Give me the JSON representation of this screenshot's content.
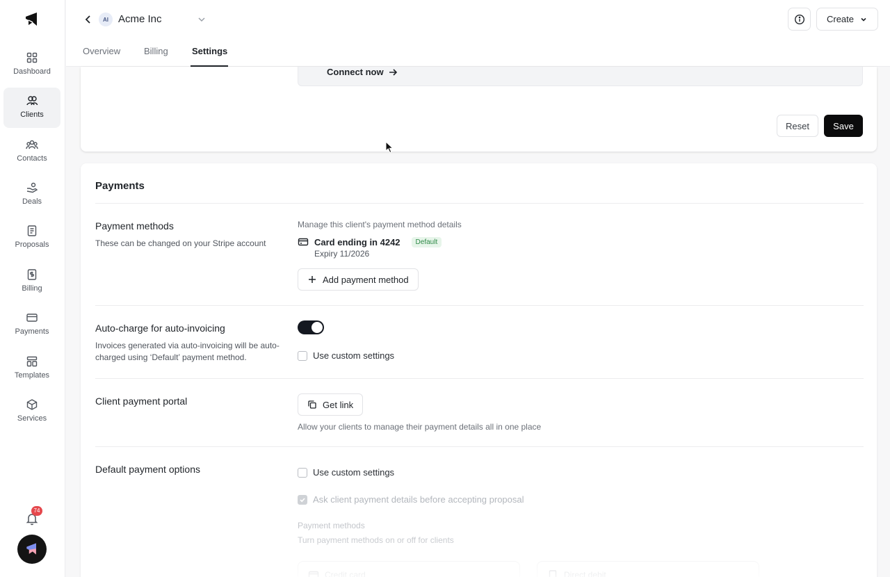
{
  "sidebar": {
    "items": [
      {
        "label": "Dashboard",
        "icon": "dashboard-icon"
      },
      {
        "label": "Clients",
        "icon": "clients-icon",
        "active": true
      },
      {
        "label": "Contacts",
        "icon": "contacts-icon"
      },
      {
        "label": "Deals",
        "icon": "deals-icon"
      },
      {
        "label": "Proposals",
        "icon": "proposals-icon"
      },
      {
        "label": "Billing",
        "icon": "billing-icon"
      },
      {
        "label": "Payments",
        "icon": "payments-icon"
      },
      {
        "label": "Templates",
        "icon": "templates-icon"
      },
      {
        "label": "Services",
        "icon": "services-icon"
      }
    ],
    "notifications_count": "74"
  },
  "header": {
    "client_initials": "AI",
    "client_name": "Acme Inc",
    "create_label": "Create",
    "tabs": [
      {
        "label": "Overview"
      },
      {
        "label": "Billing"
      },
      {
        "label": "Settings",
        "active": true
      }
    ]
  },
  "top_card": {
    "connect_label": "Connect now",
    "reset_label": "Reset",
    "save_label": "Save"
  },
  "payments": {
    "title": "Payments",
    "methods": {
      "label": "Payment methods",
      "description": "These can be changed on your Stripe account",
      "hint": "Manage this client's payment method details",
      "card_label": "Card ending in 4242",
      "card_badge": "Default",
      "card_expiry": "Expiry 11/2026",
      "add_label": "Add payment method"
    },
    "autocharge": {
      "label": "Auto-charge for auto-invoicing",
      "description": "Invoices generated via auto-invoicing will be auto-charged using ‘Default’ payment method.",
      "toggle_on": true,
      "custom_label": "Use custom settings"
    },
    "portal": {
      "label": "Client payment portal",
      "button_label": "Get link",
      "hint": "Allow your clients to manage their payment details all in one place"
    },
    "defaults": {
      "label": "Default payment options",
      "custom_label": "Use custom settings",
      "ask_label": "Ask client payment details before accepting proposal",
      "methods_label": "Payment methods",
      "methods_hint": "Turn payment methods on or off for clients",
      "option_1": "Credit card",
      "option_2": "Direct debit"
    }
  },
  "colors": {
    "primary": "#0b0b0c",
    "badge_red": "#e5484d",
    "success_green": "#2f8a48"
  }
}
